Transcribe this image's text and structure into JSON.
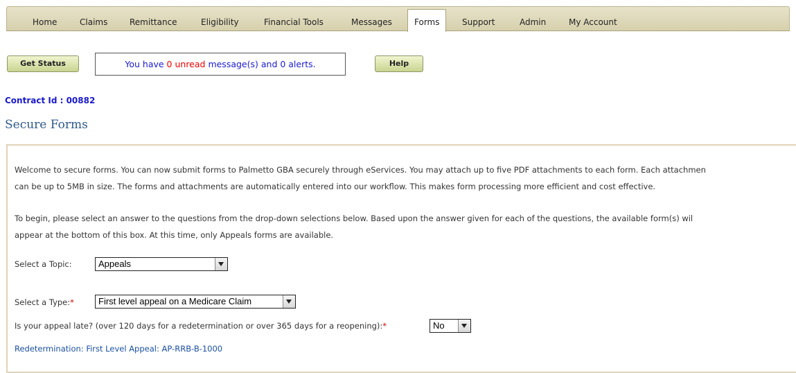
{
  "nav": {
    "tabs": [
      "Home",
      "Claims",
      "Remittance",
      "Eligibility",
      "Financial Tools",
      "Messages",
      "Forms",
      "Support",
      "Admin",
      "My Account"
    ],
    "active": "Forms"
  },
  "toolbar": {
    "get_status_label": "Get Status",
    "help_label": "Help",
    "message": {
      "prefix": "You have ",
      "count_text": "0 unread",
      "suffix": " message(s) and 0 alerts."
    }
  },
  "contract_label": "Contract Id : 00882",
  "page_title": "Secure Forms",
  "intro": {
    "line1": "Welcome to secure forms. You can now submit forms to Palmetto GBA securely through eServices. You may attach up to five PDF attachments to each form. Each attachmen",
    "line2": "can be up to 5MB in size. The forms and attachments are automatically entered into our workflow. This makes form processing more efficient and cost effective.",
    "line3": "To begin, please select an answer to the questions from the drop-down selections below. Based upon the answer given for each of the questions, the available form(s) wil",
    "line4": "appear at the bottom of this box. At this time, only Appeals forms are available."
  },
  "form": {
    "topic_label": "Select a Topic:",
    "topic_value": "Appeals",
    "type_label": "Select a Type:",
    "type_value": "First level appeal on a Medicare Claim",
    "late_label": "Is your appeal late? (over 120 days for a redetermination or over 365 days for a reopening):",
    "late_value": "No",
    "required_mark": "*"
  },
  "result_link": "Redetermination: First Level Appeal: AP-RRB-B-1000"
}
